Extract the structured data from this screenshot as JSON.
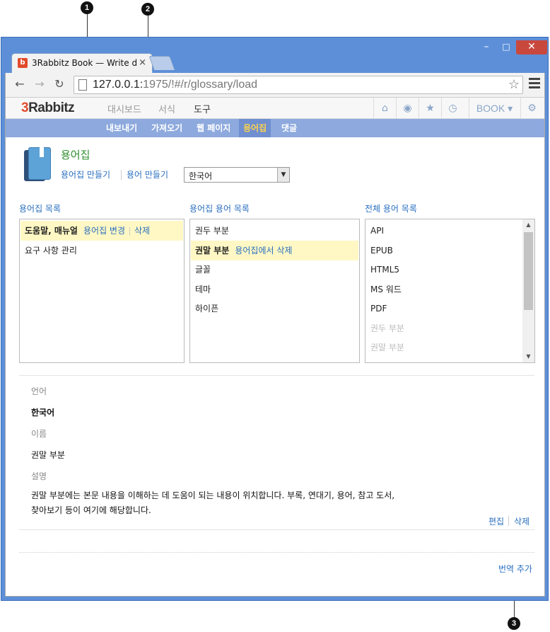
{
  "callouts": [
    "1",
    "2",
    "3"
  ],
  "browser": {
    "tab_title": "3Rabbitz Book — Write d",
    "tab_favicon": "b",
    "tab_close": "×",
    "url_host": "127.0.0.1:",
    "url_rest": "1975/!#/r/glossary/load",
    "window_min": "–",
    "window_max": "□",
    "window_close": "✕"
  },
  "app": {
    "logo_three": "3",
    "logo_rest": "Rabbitz",
    "main_nav": [
      "대시보드",
      "서식",
      "도구"
    ],
    "book_menu": "BOOK ▾",
    "sub_nav": [
      "내보내기",
      "가져오기",
      "웹 페이지",
      "용어집",
      "댓글"
    ]
  },
  "page": {
    "title": "용어집",
    "create_glossary": "용어집 만들기",
    "create_term": "용어 만들기",
    "language_select": "한국어"
  },
  "glossary_list": {
    "title": "용어집 목록",
    "items": [
      {
        "label": "도움말, 매뉴얼",
        "edit": "용어집 변경",
        "delete": "삭제"
      },
      {
        "label": "요구 사항 관리"
      }
    ]
  },
  "glossary_terms": {
    "title": "용어집 용어 목록",
    "items": [
      "권두 부분",
      "권말 부분",
      "글꼴",
      "테마",
      "하이픈"
    ],
    "selected_action": "용어집에서 삭제"
  },
  "all_terms": {
    "title": "전체 용어 목록",
    "items": [
      "API",
      "EPUB",
      "HTML5",
      "MS 워드",
      "PDF",
      "권두 부분",
      "권말 부분"
    ]
  },
  "detail": {
    "language_label": "언어",
    "language_value": "한국어",
    "name_label": "이름",
    "name_value": "권말 부분",
    "desc_label": "설명",
    "desc_line1": "권말 부분에는 본문 내용을 이해하는 데 도움이 되는 내용이 위치합니다. 부록, 연대기, 용어, 참고 도서,",
    "desc_line2": "찾아보기 등이 여기에 해당합니다.",
    "edit": "편집",
    "delete": "삭제",
    "add_translation": "번역 추가"
  }
}
